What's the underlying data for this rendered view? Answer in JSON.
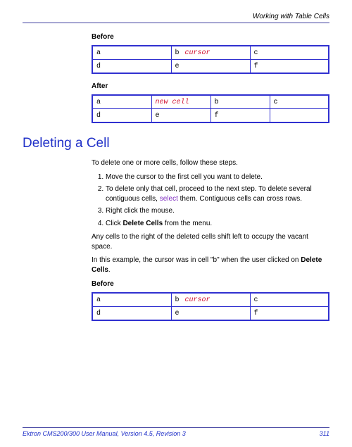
{
  "header": {
    "title": "Working with Table Cells"
  },
  "labels": {
    "before": "Before",
    "after": "After"
  },
  "table_before_1": {
    "rows": [
      [
        "a",
        "b",
        "c"
      ],
      [
        "d",
        "e",
        "f"
      ]
    ],
    "cursor_row": 0,
    "cursor_col": 1,
    "cursor_text": "cursor"
  },
  "table_after": {
    "rows": [
      [
        "a",
        "",
        "b",
        "c"
      ],
      [
        "d",
        "e",
        "f",
        ""
      ]
    ],
    "newcell_row": 0,
    "newcell_col": 1,
    "newcell_text": "new cell"
  },
  "section": {
    "heading": "Deleting a Cell",
    "intro": "To delete one or more cells, follow these steps.",
    "steps": [
      "Move the cursor to the first cell you want to delete.",
      "To delete only that cell, proceed to the next step. To delete several contiguous cells, select them. Contiguous cells can cross rows.",
      "Right click the mouse.",
      "Click Delete Cells from the menu."
    ],
    "step2_link_word": "select",
    "step4_bold": "Delete Cells",
    "after_steps": "Any cells to the right of the deleted cells shift left to occupy the vacant space.",
    "example_text_1": "In this example, the cursor was in cell \"b\" when the user clicked on ",
    "example_bold": "Delete Cells",
    "example_text_2": "."
  },
  "table_before_2": {
    "rows": [
      [
        "a",
        "b",
        "c"
      ],
      [
        "d",
        "e",
        "f"
      ]
    ],
    "cursor_row": 0,
    "cursor_col": 1,
    "cursor_text": "cursor"
  },
  "footer": {
    "left": "Ektron CMS200/300 User Manual, Version 4.5, Revision 3",
    "right": "311"
  }
}
